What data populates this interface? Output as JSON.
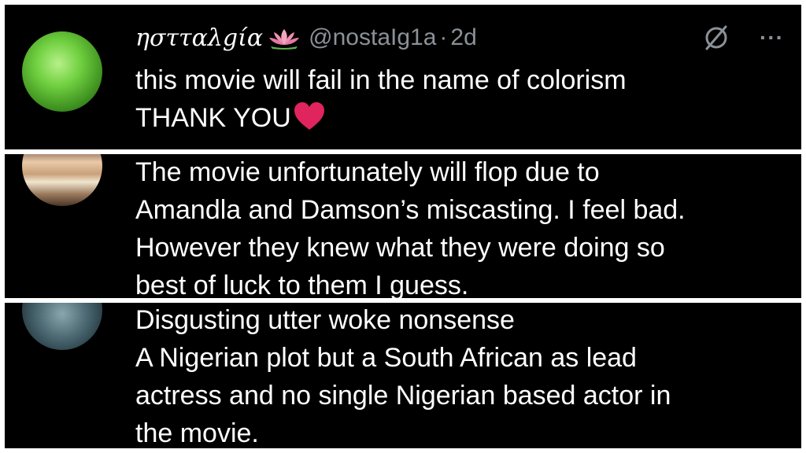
{
  "colors": {
    "panel_background": "#000000",
    "text_primary": "#ffffff",
    "text_secondary": "#8b9198",
    "heart": "#e0245e"
  },
  "posts": [
    {
      "display_name": "ηστταλgία",
      "name_emoji": "lotus-icon",
      "handle": "@nostaIg1a",
      "separator": "·",
      "timestamp": "2d",
      "lines": [
        "this movie will fail in the name of colorism",
        "THANK YOU"
      ],
      "trailing_emoji": "heart-icon"
    },
    {
      "lines": [
        "The movie unfortunately will flop due to",
        "Amandla and Damson’s miscasting. I feel bad.",
        "However they knew what they were doing so",
        "best of luck to them I guess."
      ]
    },
    {
      "lines": [
        "Disgusting utter woke nonsense",
        "A Nigerian plot but a South African as lead",
        "actress and no single Nigerian based actor in",
        "the movie."
      ]
    }
  ]
}
